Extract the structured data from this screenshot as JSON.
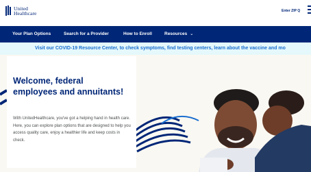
{
  "header": {
    "logo_line1": "United",
    "logo_line2": "Healthcare",
    "enter_zip": "Enter ZIP Q"
  },
  "nav": {
    "items": [
      {
        "label": "Your Plan Options"
      },
      {
        "label": "Search for a Provider"
      },
      {
        "label": "How to Enroll"
      },
      {
        "label": "Resources",
        "icon": "chevron-down-icon"
      }
    ]
  },
  "banner": {
    "text": "Visit our COVID-19 Resource Center, to check symptoms, find testing centers, learn about the vaccine and mo"
  },
  "hero": {
    "headline": "Welcome, federal employees and annuitants!",
    "body": "With UnitedHealthcare, you've got a helping hand in health care. Here, you can explore plan options that are designed to help you access quality care, enjoy a healthier life and keep costs in check."
  },
  "colors": {
    "brand": "#002677",
    "banner_bg": "#e5f8fb",
    "banner_text": "#196ecf",
    "hero_bg": "#faf8f2"
  }
}
